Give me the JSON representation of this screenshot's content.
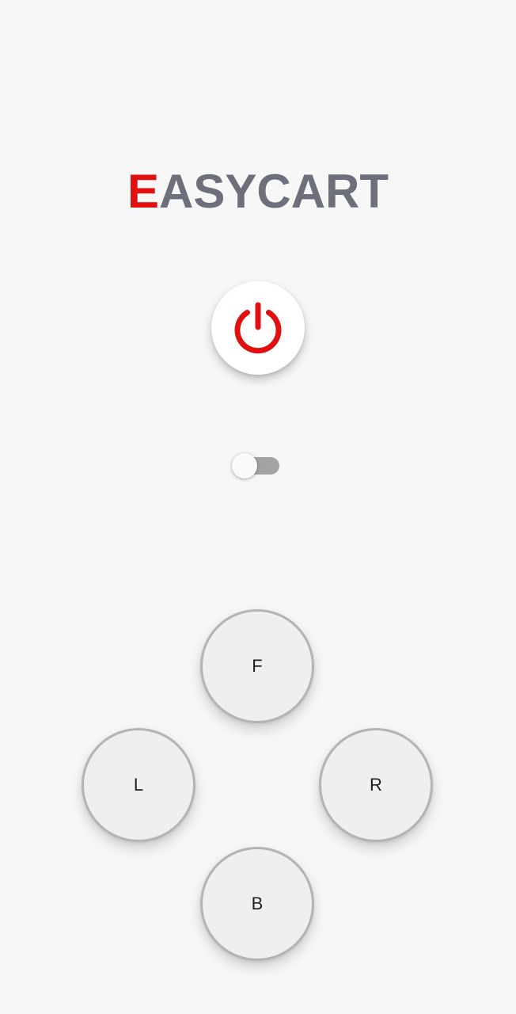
{
  "app": {
    "logo_first_letter": "E",
    "logo_rest": "ASYCART"
  },
  "power": {
    "icon": "power-icon"
  },
  "toggle": {
    "state": "off"
  },
  "controls": {
    "forward_label": "F",
    "left_label": "L",
    "right_label": "R",
    "back_label": "B"
  },
  "colors": {
    "accent": "#e01010",
    "logo_text": "#6d6f7a",
    "background": "#f7f7f7",
    "button_fill": "#efefef",
    "button_border": "#b4b4b4",
    "toggle_track_off": "#a3a3a3"
  }
}
